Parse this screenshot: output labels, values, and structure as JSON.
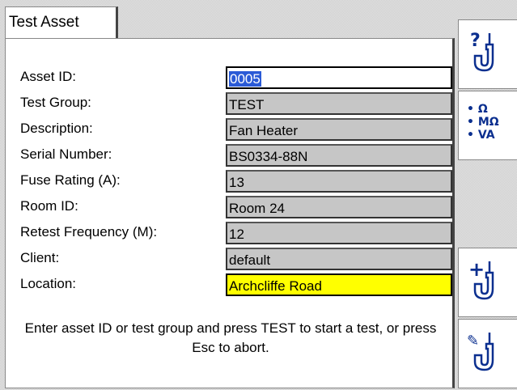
{
  "window": {
    "tab_title": "Test Asset"
  },
  "form": {
    "fields": [
      {
        "label": "Asset ID:",
        "value": "0005"
      },
      {
        "label": "Test Group:",
        "value": "TEST"
      },
      {
        "label": "Description:",
        "value": "Fan Heater"
      },
      {
        "label": "Serial Number:",
        "value": "BS0334-88N"
      },
      {
        "label": "Fuse Rating (A):",
        "value": "13"
      },
      {
        "label": "Room ID:",
        "value": "Room 24"
      },
      {
        "label": "Retest Frequency (M):",
        "value": "12"
      },
      {
        "label": "Client:",
        "value": "default"
      },
      {
        "label": "Location:",
        "value": "Archcliffe Road"
      }
    ],
    "help_text": "Enter asset ID or test group and press TEST to start a test, or press Esc to abort."
  },
  "function_keys": [
    {
      "icon": "help-probe-icon",
      "glyph": "?"
    },
    {
      "icon": "units-icon",
      "units": [
        "Ω",
        "MΩ",
        "VA"
      ]
    },
    {
      "icon": "add-probe-icon",
      "glyph": "+"
    },
    {
      "icon": "edit-probe-icon",
      "glyph": "✎"
    }
  ],
  "colors": {
    "selection": "#2a5ad6",
    "highlight_field": "#ffff00",
    "readonly_field": "#c6c6c6",
    "icon_blue": "#0b2f8f"
  }
}
